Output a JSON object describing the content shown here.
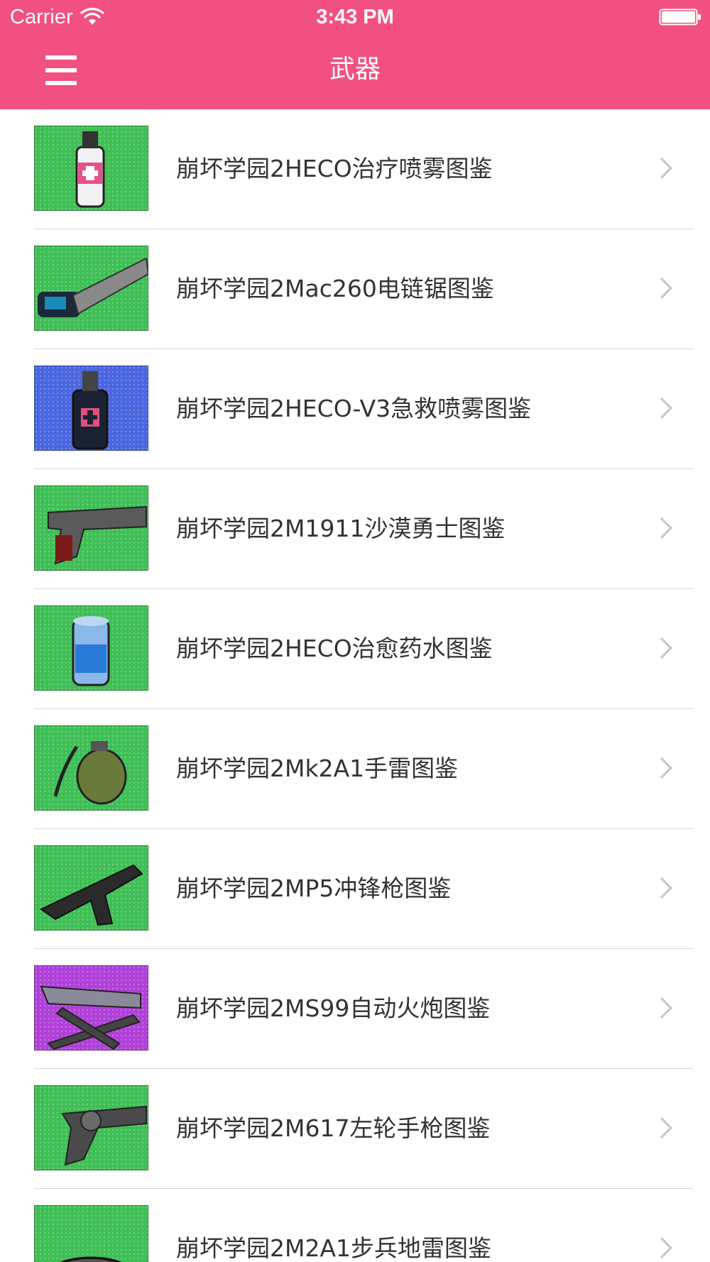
{
  "status_bar": {
    "carrier": "Carrier",
    "time": "3:43 PM"
  },
  "nav_bar": {
    "title": "武器",
    "menu_icon": "hamburger-menu-icon"
  },
  "colors": {
    "header_bg": "#f25080",
    "header_text": "#ffffff",
    "item_text": "#333333",
    "divider": "#d6d6d6",
    "chevron": "#c7c7cc"
  },
  "items": [
    {
      "label": "崩坏学园2HECO治疗喷雾图鉴",
      "thumb_bg": "#3fbf55",
      "icon": "spray-bottle-pink"
    },
    {
      "label": "崩坏学园2Mac260电链锯图鉴",
      "thumb_bg": "#3fbf55",
      "icon": "chainsaw"
    },
    {
      "label": "崩坏学园2HECO-V3急救喷雾图鉴",
      "thumb_bg": "#4a66e0",
      "icon": "spray-bottle-blue"
    },
    {
      "label": "崩坏学园2M1911沙漠勇士图鉴",
      "thumb_bg": "#3fbf55",
      "icon": "pistol"
    },
    {
      "label": "崩坏学园2HECO治愈药水图鉴",
      "thumb_bg": "#3fbf55",
      "icon": "potion-can"
    },
    {
      "label": "崩坏学园2Mk2A1手雷图鉴",
      "thumb_bg": "#3fbf55",
      "icon": "grenade"
    },
    {
      "label": "崩坏学园2MP5冲锋枪图鉴",
      "thumb_bg": "#3fbf55",
      "icon": "submachine-gun"
    },
    {
      "label": "崩坏学园2MS99自动火炮图鉴",
      "thumb_bg": "#b040d8",
      "icon": "autocannon"
    },
    {
      "label": "崩坏学园2M617左轮手枪图鉴",
      "thumb_bg": "#3fbf55",
      "icon": "revolver"
    },
    {
      "label": "崩坏学园2M2A1步兵地雷图鉴",
      "thumb_bg": "#3fbf55",
      "icon": "landmine"
    }
  ]
}
